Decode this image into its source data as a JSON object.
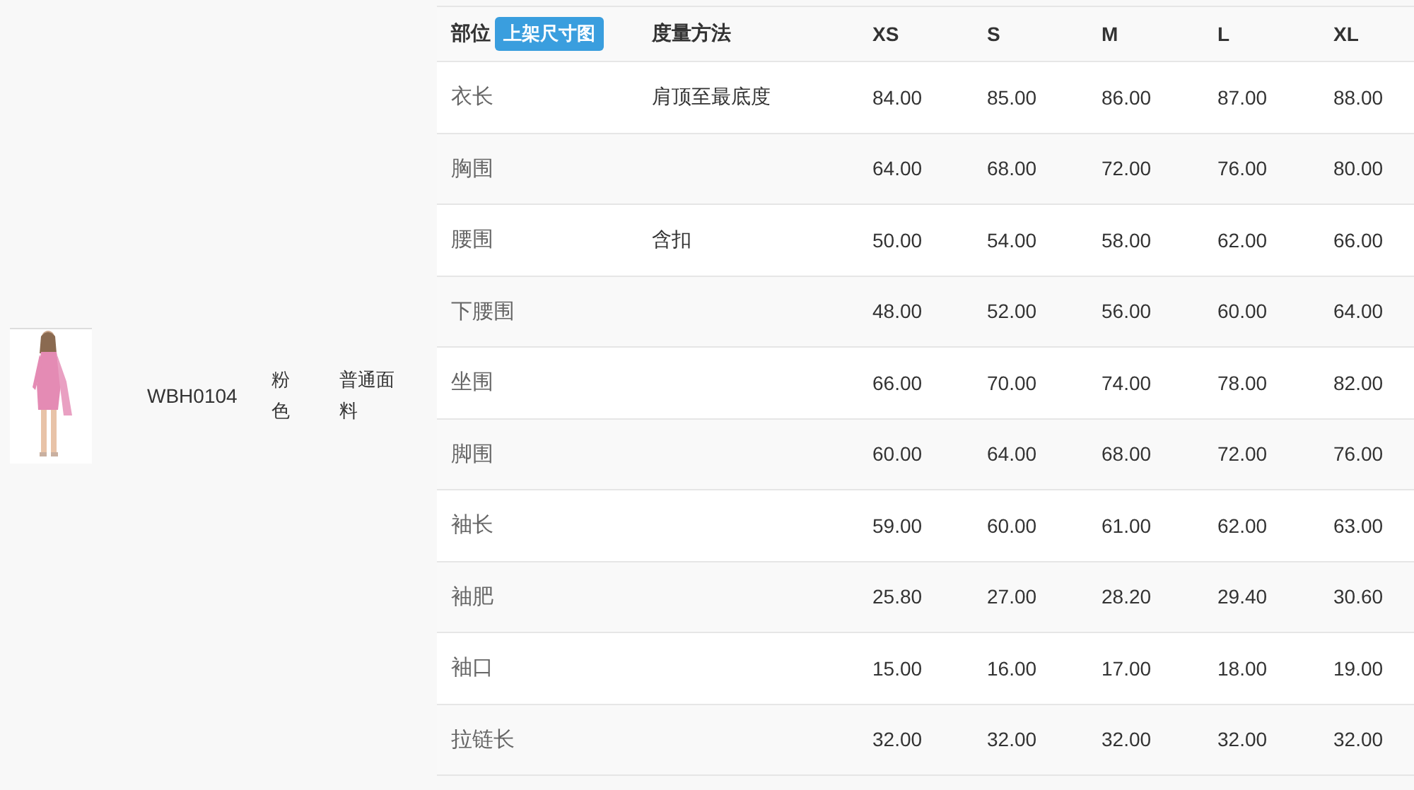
{
  "product": {
    "code": "WBH0104",
    "color_name": "粉色",
    "fabric": "普通面料"
  },
  "size_table": {
    "columns": [
      {
        "label": "部位",
        "button": "上架尺寸图"
      },
      {
        "label": "度量方法"
      },
      {
        "label": "XS"
      },
      {
        "label": "S"
      },
      {
        "label": "M"
      },
      {
        "label": "L"
      },
      {
        "label": "XL"
      }
    ],
    "rows": [
      {
        "part": "衣长",
        "method": "肩顶至最底度",
        "values": [
          "84.00",
          "85.00",
          "86.00",
          "87.00",
          "88.00"
        ]
      },
      {
        "part": "胸围",
        "values": [
          "64.00",
          "68.00",
          "72.00",
          "76.00",
          "80.00"
        ]
      },
      {
        "part": "腰围",
        "method": "含扣",
        "values": [
          "50.00",
          "54.00",
          "58.00",
          "62.00",
          "66.00"
        ]
      },
      {
        "part": "下腰围",
        "values": [
          "48.00",
          "52.00",
          "56.00",
          "60.00",
          "64.00"
        ]
      },
      {
        "part": "坐围",
        "values": [
          "66.00",
          "70.00",
          "74.00",
          "78.00",
          "82.00"
        ]
      },
      {
        "part": "脚围",
        "values": [
          "60.00",
          "64.00",
          "68.00",
          "72.00",
          "76.00"
        ]
      },
      {
        "part": "袖长",
        "values": [
          "59.00",
          "60.00",
          "61.00",
          "62.00",
          "63.00"
        ]
      },
      {
        "part": "袖肥",
        "values": [
          "25.80",
          "27.00",
          "28.20",
          "29.40",
          "30.60"
        ]
      },
      {
        "part": "袖口",
        "values": [
          "15.00",
          "16.00",
          "17.00",
          "18.00",
          "19.00"
        ]
      },
      {
        "part": "拉链长",
        "values": [
          "32.00",
          "32.00",
          "32.00",
          "32.00",
          "32.00"
        ]
      }
    ]
  }
}
